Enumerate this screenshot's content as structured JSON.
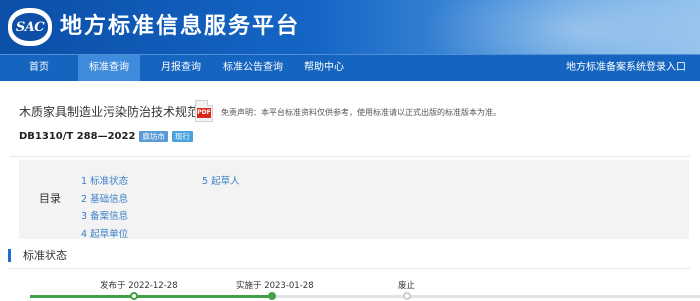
{
  "header": {
    "logo_text": "SAC",
    "site_title": "地方标准信息服务平台"
  },
  "nav": {
    "items": [
      {
        "label": "首页",
        "active": false
      },
      {
        "label": "标准查询",
        "active": true
      },
      {
        "label": "月报查询",
        "active": false
      },
      {
        "label": "标准公告查询",
        "active": false
      },
      {
        "label": "帮助中心",
        "active": false
      }
    ],
    "right_link": "地方标准备案系统登录入口"
  },
  "standard": {
    "name": "木质家具制造业污染防治技术规范",
    "code": "DB1310/T 288—2022",
    "region_badge": "廊坊市",
    "status_badge": "现行",
    "pdf_icon_label": "PDF",
    "disclaimer": "免责声明：本平台标准资料仅供参考，使用标准请以正式出版的标准版本为准。"
  },
  "toc": {
    "label": "目录",
    "items": [
      {
        "num": "1",
        "label": "标准状态"
      },
      {
        "num": "2",
        "label": "基础信息"
      },
      {
        "num": "3",
        "label": "备案信息"
      },
      {
        "num": "4",
        "label": "起草单位"
      },
      {
        "num": "5",
        "label": "起草人"
      }
    ]
  },
  "status_section": {
    "title": "标准状态",
    "timeline": [
      {
        "label": "发布于 2022-12-28",
        "state": "done"
      },
      {
        "label": "实施于 2023-01-28",
        "state": "current"
      },
      {
        "label": "废止",
        "state": "pending"
      }
    ],
    "colors": {
      "done": "#43a047",
      "pending": "#cccccc",
      "track": "#e3e3e3"
    }
  },
  "colors": {
    "banner": "#1565c0",
    "nav_active": "#3f8bdc",
    "link": "#3a7fc7",
    "region_badge": "#5b9bd5",
    "status_badge": "#4aa3df",
    "pdf_red": "#d9261c"
  },
  "icons": {
    "logo": "sac-logo",
    "pdf": "pdf-file-icon"
  }
}
